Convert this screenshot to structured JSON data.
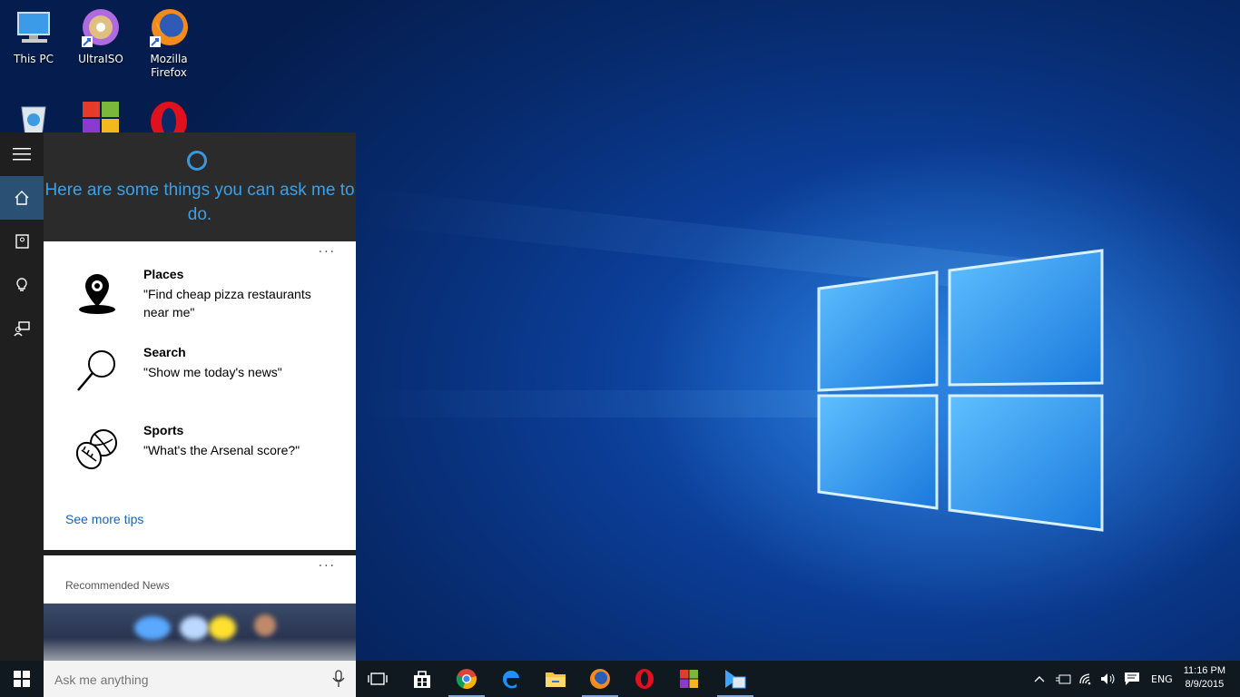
{
  "desktop": {
    "icons": [
      {
        "label": "This PC",
        "icon": "this-pc-icon"
      },
      {
        "label": "UltraISO",
        "icon": "ultraiso-icon"
      },
      {
        "label": "Mozilla Firefox",
        "icon": "firefox-icon"
      },
      {
        "label": "",
        "icon": "recycle-bin-icon"
      },
      {
        "label": "",
        "icon": "colorful-app-icon"
      },
      {
        "label": "",
        "icon": "opera-icon"
      }
    ]
  },
  "cortana": {
    "title": "Here are some things you can ask me to do.",
    "rail": [
      "menu-icon",
      "home-icon",
      "notebook-icon",
      "lightbulb-icon",
      "feedback-icon"
    ],
    "tips": [
      {
        "title": "Places",
        "query": "\"Find cheap pizza restaurants near me\"",
        "icon": "places-icon"
      },
      {
        "title": "Search",
        "query": "\"Show me today's news\"",
        "icon": "search-icon"
      },
      {
        "title": "Sports",
        "query": "\"What's the Arsenal score?\"",
        "icon": "sports-icon"
      }
    ],
    "more_dots": "···",
    "see_more": "See more tips",
    "news_label": "Recommended News"
  },
  "taskbar": {
    "search_placeholder": "Ask me anything",
    "apps": [
      "task-view-icon",
      "store-icon",
      "chrome-icon",
      "edge-icon",
      "file-explorer-icon",
      "firefox-icon",
      "opera-icon",
      "colorful-app-icon",
      "media-app-icon"
    ],
    "language": "ENG",
    "time": "11:16 PM",
    "date": "8/9/2015"
  },
  "colors": {
    "accent": "#3ea0e8",
    "link": "#1764b0",
    "rail_active": "#2a5073"
  }
}
